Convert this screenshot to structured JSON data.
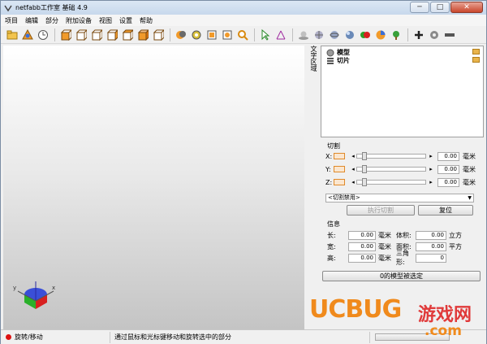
{
  "window": {
    "title": "netfabb工作室 基础 4.9",
    "min": "─",
    "max": "□",
    "close": "✕"
  },
  "menu": [
    "项目",
    "编辑",
    "部分",
    "附加设备",
    "视图",
    "设置",
    "帮助"
  ],
  "side_tab": "文字区域",
  "tree": {
    "items": [
      "模型",
      "切片"
    ]
  },
  "cut": {
    "title": "切割",
    "rows": [
      {
        "axis": "X:",
        "value": "0.00",
        "unit": "毫米"
      },
      {
        "axis": "Y:",
        "value": "0.00",
        "unit": "毫米"
      },
      {
        "axis": "Z:",
        "value": "0.00",
        "unit": "毫米"
      }
    ],
    "left_arrow": "◂",
    "right_arrow": "▸",
    "select_value": "<切割禁用>",
    "execute": "执行切割",
    "reset": "复位"
  },
  "info": {
    "title": "信息",
    "rows": [
      {
        "label": "长:",
        "value": "0.00",
        "unit": "毫米",
        "label2": "体积:",
        "value2": "0.00",
        "unit2": "立方"
      },
      {
        "label": "宽:",
        "value": "0.00",
        "unit": "毫米",
        "label2": "面积:",
        "value2": "0.00",
        "unit2": "平方"
      },
      {
        "label": "高:",
        "value": "0.00",
        "unit": "毫米",
        "label2": "三角形:",
        "value2": "0",
        "unit2": ""
      }
    ],
    "selected": "0的模型被选定"
  },
  "status": {
    "mode": "旋转/移动",
    "hint": "通过鼠标和光标键移动和旋转选中的部分"
  },
  "axes": {
    "x": "x",
    "y": "y"
  },
  "watermark": {
    "brand": "UCBUG",
    "cn": "游戏网",
    "domain": ".com"
  },
  "colors": {
    "accent": "#f08a1c",
    "red": "#e03a3a"
  }
}
